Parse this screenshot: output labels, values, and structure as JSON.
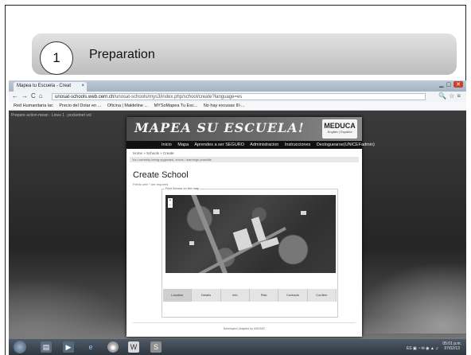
{
  "step": {
    "number": "1",
    "title": "Preparation"
  },
  "browser": {
    "tab_title": "Mapea tu Escuela - Creat",
    "tab_close": "×",
    "url_host": "unosat-schools.web.cern.ch",
    "url_path": "/unosat-schools/mys3/index.php/school/create?language=es",
    "bookmarks": [
      "Red Humanitaria lac",
      "Precio del Dolar en ...",
      "Oficina | Maldeline ...",
      "MYSoMapea Tu Esc...",
      "No hay excusas III-..."
    ],
    "notice_bar": "Prepare action-mean : Linux 1 : pocketnet vol"
  },
  "site": {
    "logo": "MAPEA SU ESCUELA!",
    "partner_logo": "MEDUCA",
    "partner_sub": "English | Español",
    "menu": [
      "Inicio",
      "Mapa",
      "Aprendes a ser SEGURO",
      "Administracion",
      "Instrucciones",
      "Desloguearse(UNICEFadmin)"
    ],
    "breadcrumb": "Home » Schools » Create",
    "notice": "You currently being upgraded, errors / warnings possible",
    "page_title": "Create School",
    "required_note": "Fields with * are required",
    "fieldset_legend": "Find School on the map",
    "wizard_tabs": [
      "Location",
      "Details",
      "Info",
      "Risk",
      "Contacts",
      "Confirm"
    ],
    "footer": "Deveioped | Adapted by UNOSAT"
  },
  "taskbar": {
    "tray_text": "ES",
    "time": "05:01 p.m.",
    "date": "07/02/13"
  }
}
